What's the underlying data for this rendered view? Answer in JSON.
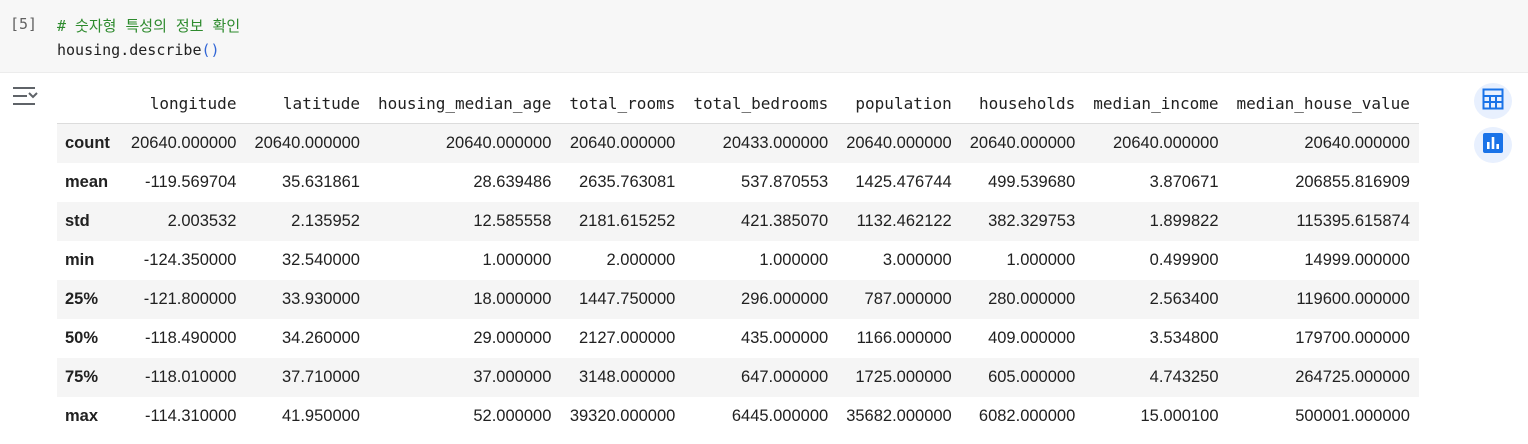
{
  "cell": {
    "execution_count": "[5]",
    "code_comment": "# 숫자형 특성의 정보 확인",
    "code_call": "housing.describe",
    "code_open_paren": "(",
    "code_close_paren": ")"
  },
  "output": {
    "toggle_icon": "output-collapse-icon",
    "table_action_icon": "table-view-icon",
    "chart_action_icon": "chart-suggestion-icon",
    "accent_color": "#1a73e8"
  },
  "dataframe": {
    "index_header": "",
    "columns": [
      "longitude",
      "latitude",
      "housing_median_age",
      "total_rooms",
      "total_bedrooms",
      "population",
      "households",
      "median_income",
      "median_house_value"
    ],
    "rows": [
      {
        "label": "count",
        "values": [
          "20640.000000",
          "20640.000000",
          "20640.000000",
          "20640.000000",
          "20433.000000",
          "20640.000000",
          "20640.000000",
          "20640.000000",
          "20640.000000"
        ]
      },
      {
        "label": "mean",
        "values": [
          "-119.569704",
          "35.631861",
          "28.639486",
          "2635.763081",
          "537.870553",
          "1425.476744",
          "499.539680",
          "3.870671",
          "206855.816909"
        ]
      },
      {
        "label": "std",
        "values": [
          "2.003532",
          "2.135952",
          "12.585558",
          "2181.615252",
          "421.385070",
          "1132.462122",
          "382.329753",
          "1.899822",
          "115395.615874"
        ]
      },
      {
        "label": "min",
        "values": [
          "-124.350000",
          "32.540000",
          "1.000000",
          "2.000000",
          "1.000000",
          "3.000000",
          "1.000000",
          "0.499900",
          "14999.000000"
        ]
      },
      {
        "label": "25%",
        "values": [
          "-121.800000",
          "33.930000",
          "18.000000",
          "1447.750000",
          "296.000000",
          "787.000000",
          "280.000000",
          "2.563400",
          "119600.000000"
        ]
      },
      {
        "label": "50%",
        "values": [
          "-118.490000",
          "34.260000",
          "29.000000",
          "2127.000000",
          "435.000000",
          "1166.000000",
          "409.000000",
          "3.534800",
          "179700.000000"
        ]
      },
      {
        "label": "75%",
        "values": [
          "-118.010000",
          "37.710000",
          "37.000000",
          "3148.000000",
          "647.000000",
          "1725.000000",
          "605.000000",
          "4.743250",
          "264725.000000"
        ]
      },
      {
        "label": "max",
        "values": [
          "-114.310000",
          "41.950000",
          "52.000000",
          "39320.000000",
          "6445.000000",
          "35682.000000",
          "6082.000000",
          "15.000100",
          "500001.000000"
        ]
      }
    ]
  }
}
